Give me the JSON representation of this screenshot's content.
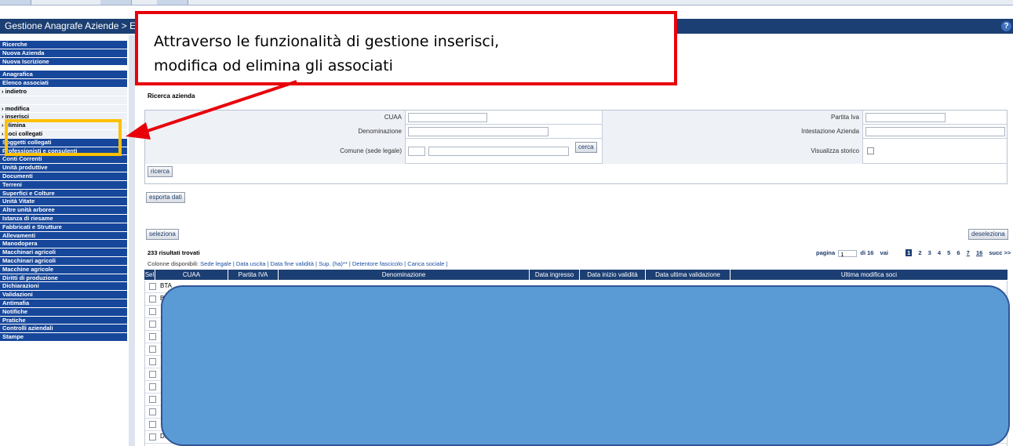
{
  "header": {
    "title": "Gestione Anagrafe Aziende > E"
  },
  "sidebar": {
    "items": [
      {
        "label": "Ricerche",
        "type": "main"
      },
      {
        "label": "Nuova Azienda",
        "type": "main"
      },
      {
        "label": "Nuova Iscrizione",
        "type": "main"
      },
      {
        "label": "",
        "type": "gap"
      },
      {
        "label": "Anagrafica",
        "type": "main"
      },
      {
        "label": "Elenco associati",
        "type": "main"
      },
      {
        "label": "› indietro",
        "type": "sub"
      },
      {
        "label": "",
        "type": "sub"
      },
      {
        "label": "› modifica",
        "type": "sub"
      },
      {
        "label": "› inserisci",
        "type": "sub"
      },
      {
        "label": "› elimina",
        "type": "sub"
      },
      {
        "label": "› soci collegati",
        "type": "sub"
      },
      {
        "label": "Soggetti collegati",
        "type": "main"
      },
      {
        "label": "Professionisti e consulenti",
        "type": "main"
      },
      {
        "label": "Conti Correnti",
        "type": "main"
      },
      {
        "label": "Unità produttive",
        "type": "main"
      },
      {
        "label": "Documenti",
        "type": "main"
      },
      {
        "label": "Terreni",
        "type": "main"
      },
      {
        "label": "Superfici e Colture",
        "type": "main"
      },
      {
        "label": "Unità Vitate",
        "type": "main"
      },
      {
        "label": "Altre unità arboree",
        "type": "main"
      },
      {
        "label": "Istanza di riesame",
        "type": "main"
      },
      {
        "label": "Fabbricati e Strutture",
        "type": "main"
      },
      {
        "label": "Allevamenti",
        "type": "main"
      },
      {
        "label": "Manodopera",
        "type": "main"
      },
      {
        "label": "Macchinari agricoli",
        "type": "main"
      },
      {
        "label": "Macchinari agricoli",
        "type": "main"
      },
      {
        "label": "Macchine agricole",
        "type": "main"
      },
      {
        "label": "Diritti di produzione",
        "type": "main"
      },
      {
        "label": "Dichiarazioni",
        "type": "main"
      },
      {
        "label": "Validazioni",
        "type": "main"
      },
      {
        "label": "Antimafia",
        "type": "main"
      },
      {
        "label": "Notifiche",
        "type": "main"
      },
      {
        "label": "Pratiche",
        "type": "main"
      },
      {
        "label": "Controlli aziendali",
        "type": "main"
      },
      {
        "label": "Stampe",
        "type": "main"
      }
    ]
  },
  "callout": {
    "line1": "Attraverso le funzionalità di gestione inserisci,",
    "line2": "modifica od elimina gli associati"
  },
  "search": {
    "title": "Ricerca azienda",
    "cuaa_label": "CUAA",
    "partita_iva_label": "Partita Iva",
    "denominazione_label": "Denominazione",
    "intestazione_label": "Intestazione Azienda",
    "comune_label": "Comune (sede legale)",
    "cerca_button": "cerca",
    "visualizza_storico_label": "Visualizza storico",
    "ricerca_button": "ricerca"
  },
  "actions": {
    "esporta_button": "esporta dati",
    "seleziona_button": "seleziona",
    "deseleziona_button": "deseleziona"
  },
  "results": {
    "count_text": "233 risultati trovati",
    "pagina_label": "pagina",
    "page_value": "1",
    "of_text": "di 16",
    "vai_label": "vai",
    "pages": [
      "1",
      "2",
      "3",
      "4",
      "5",
      "6",
      "7",
      "16"
    ],
    "next_label": "succ >>",
    "colonne_label": "Colonne disponibili:",
    "colonne_links": "Sede legale | Data uscita | Data fine validità | Sup. (ha)** | Detentore fascicolo | Carica sociale |"
  },
  "table": {
    "headers": [
      "Sel",
      "CUAA",
      "Partita IVA",
      "Denominazione",
      "Data ingresso",
      "Data inizio validità",
      "Data ultima validazione",
      "Ultima modifica soci"
    ],
    "rows": [
      {
        "cuaa": "BTA"
      },
      {
        "cuaa": "B"
      },
      {
        "cuaa": ""
      },
      {
        "cuaa": ""
      },
      {
        "cuaa": ""
      },
      {
        "cuaa": ""
      },
      {
        "cuaa": ""
      },
      {
        "cuaa": ""
      },
      {
        "cuaa": ""
      },
      {
        "cuaa": ""
      },
      {
        "cuaa": ""
      },
      {
        "cuaa": ""
      },
      {
        "cuaa": "DM"
      }
    ]
  }
}
